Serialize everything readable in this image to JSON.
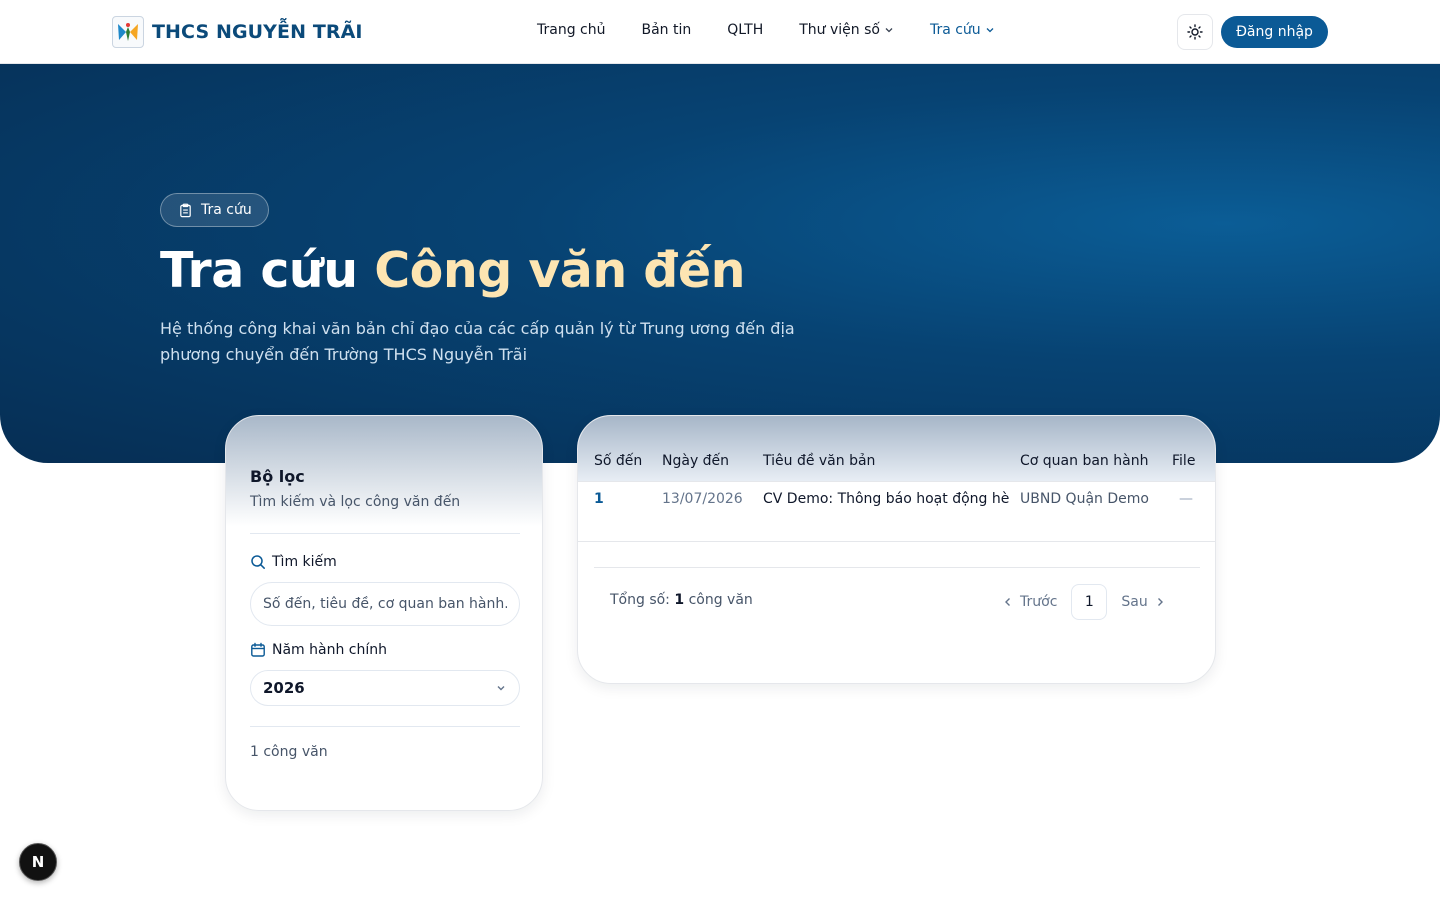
{
  "brand": {
    "name": "THCS NGUYỄN TRÃI"
  },
  "nav": {
    "items": [
      {
        "label": "Trang chủ"
      },
      {
        "label": "Bản tin"
      },
      {
        "label": "QLTH"
      },
      {
        "label": "Thư viện số"
      },
      {
        "label": "Tra cứu"
      }
    ],
    "login_label": "Đăng nhập"
  },
  "hero": {
    "badge": "Tra cứu",
    "title_plain": "Tra cứu",
    "title_accent": "Công văn đến",
    "description": "Hệ thống công khai văn bản chỉ đạo của các cấp quản lý từ Trung ương đến địa phương chuyển đến Trường THCS Nguyễn Trãi"
  },
  "filter": {
    "title": "Bộ lọc",
    "subtitle": "Tìm kiếm và lọc công văn đến",
    "search_label": "Tìm kiếm",
    "search_placeholder": "Số đến, tiêu đề, cơ quan ban hành...",
    "year_label": "Năm hành chính",
    "year_value": "2026",
    "count": "1 công văn"
  },
  "table": {
    "headers": [
      "Số đến",
      "Ngày đến",
      "Tiêu đề văn bản",
      "Cơ quan ban hành",
      "File"
    ],
    "rows": [
      {
        "so_den": "1",
        "ngay_den": "13/07/2026",
        "tieu_de": "CV Demo: Thông báo hoạt động hè",
        "co_quan": "UBND Quận Demo",
        "file": "—"
      }
    ],
    "total_prefix": "Tổng số:",
    "total_count": "1",
    "total_suffix": "công văn",
    "prev_label": "Trước",
    "page": "1",
    "next_label": "Sau"
  },
  "colors": {
    "primary": "#0b5a96",
    "accent": "#fde5b2",
    "hero_dark": "#062e54"
  },
  "floating_badge": "N"
}
